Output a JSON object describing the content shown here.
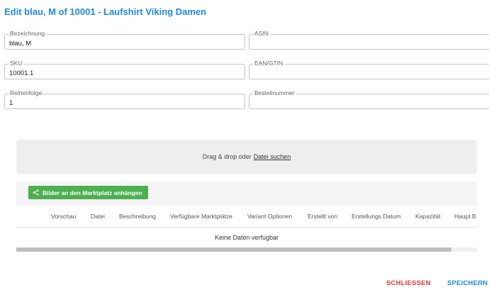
{
  "dialog": {
    "title": "Edit blau, M of 10001 - Laufshirt Viking Damen"
  },
  "fields": {
    "bezeichnung": {
      "label": "Bezeichnung",
      "value": "blau, M"
    },
    "asin": {
      "label": "ASIN",
      "value": ""
    },
    "sku": {
      "label": "SKU",
      "value": "10001.1"
    },
    "ean": {
      "label": "EAN/GTIN",
      "value": ""
    },
    "reihenfolge": {
      "label": "Reihenfolge",
      "value": "1"
    },
    "bestellnummer": {
      "label": "Bestellnummer",
      "value": ""
    }
  },
  "dropzone": {
    "text": "Drag & drop oder",
    "link": "Datei suchen"
  },
  "images_table": {
    "attach_button": "Bilder an den Marktplatz anhängen",
    "attach_icon": "share-icon",
    "columns": [
      "Vorschau",
      "Datei",
      "Beschreibung",
      "Verfügbare Marktplätze",
      "Variant Optionen",
      "Erstellt von",
      "Erstellungs Datum",
      "Kapazität",
      "Haupt B"
    ],
    "empty_text": "Keine Daten verfügbar"
  },
  "actions": {
    "close": "SCHLIESSEN",
    "save": "SPEICHERN"
  },
  "colors": {
    "title": "#1e88e5",
    "attach_button": "#4caf50",
    "close": "#e53935",
    "save": "#1e88e5"
  }
}
